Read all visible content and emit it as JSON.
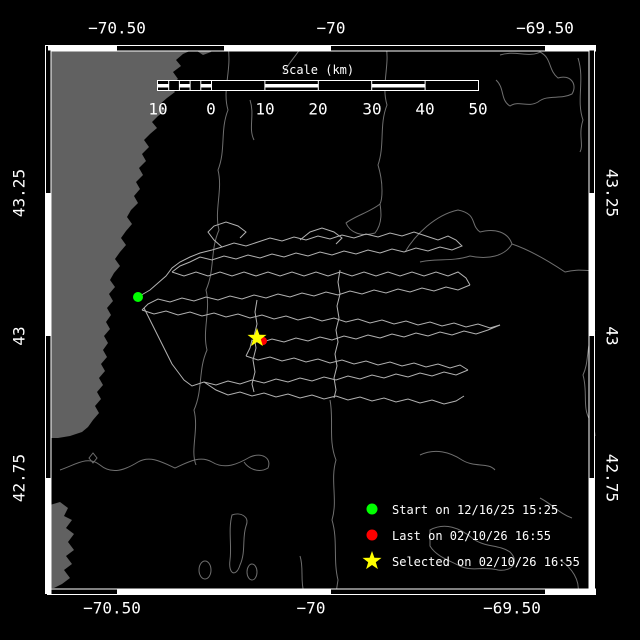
{
  "axes": {
    "top": [
      "−70.50",
      "−70",
      "−69.50"
    ],
    "bottom": [
      "−70.50",
      "−70",
      "−69.50"
    ],
    "left": [
      "43.25",
      "43",
      "42.75"
    ],
    "right": [
      "43.25",
      "43",
      "42.75"
    ]
  },
  "scalebar": {
    "title": "Scale (km)",
    "labels": [
      "10",
      "0",
      "10",
      "20",
      "30",
      "40",
      "50"
    ]
  },
  "legend": {
    "items": [
      {
        "marker": "start-circle",
        "color": "#00ff00",
        "label": "Start on 12/16/25 15:25"
      },
      {
        "marker": "last-circle",
        "color": "#ff0000",
        "label": "Last on 02/10/26 16:55"
      },
      {
        "marker": "selected-star",
        "color": "#ffff00",
        "label": "Selected on 02/10/26 16:55"
      }
    ]
  },
  "colors": {
    "background": "#000000",
    "land": "#616161",
    "contour": "#6f6f6f",
    "track": "#b2b2b2",
    "frame": "#ffffff",
    "start_marker": "#00ff00",
    "last_marker": "#ff0000",
    "selected_marker": "#ffff00"
  }
}
